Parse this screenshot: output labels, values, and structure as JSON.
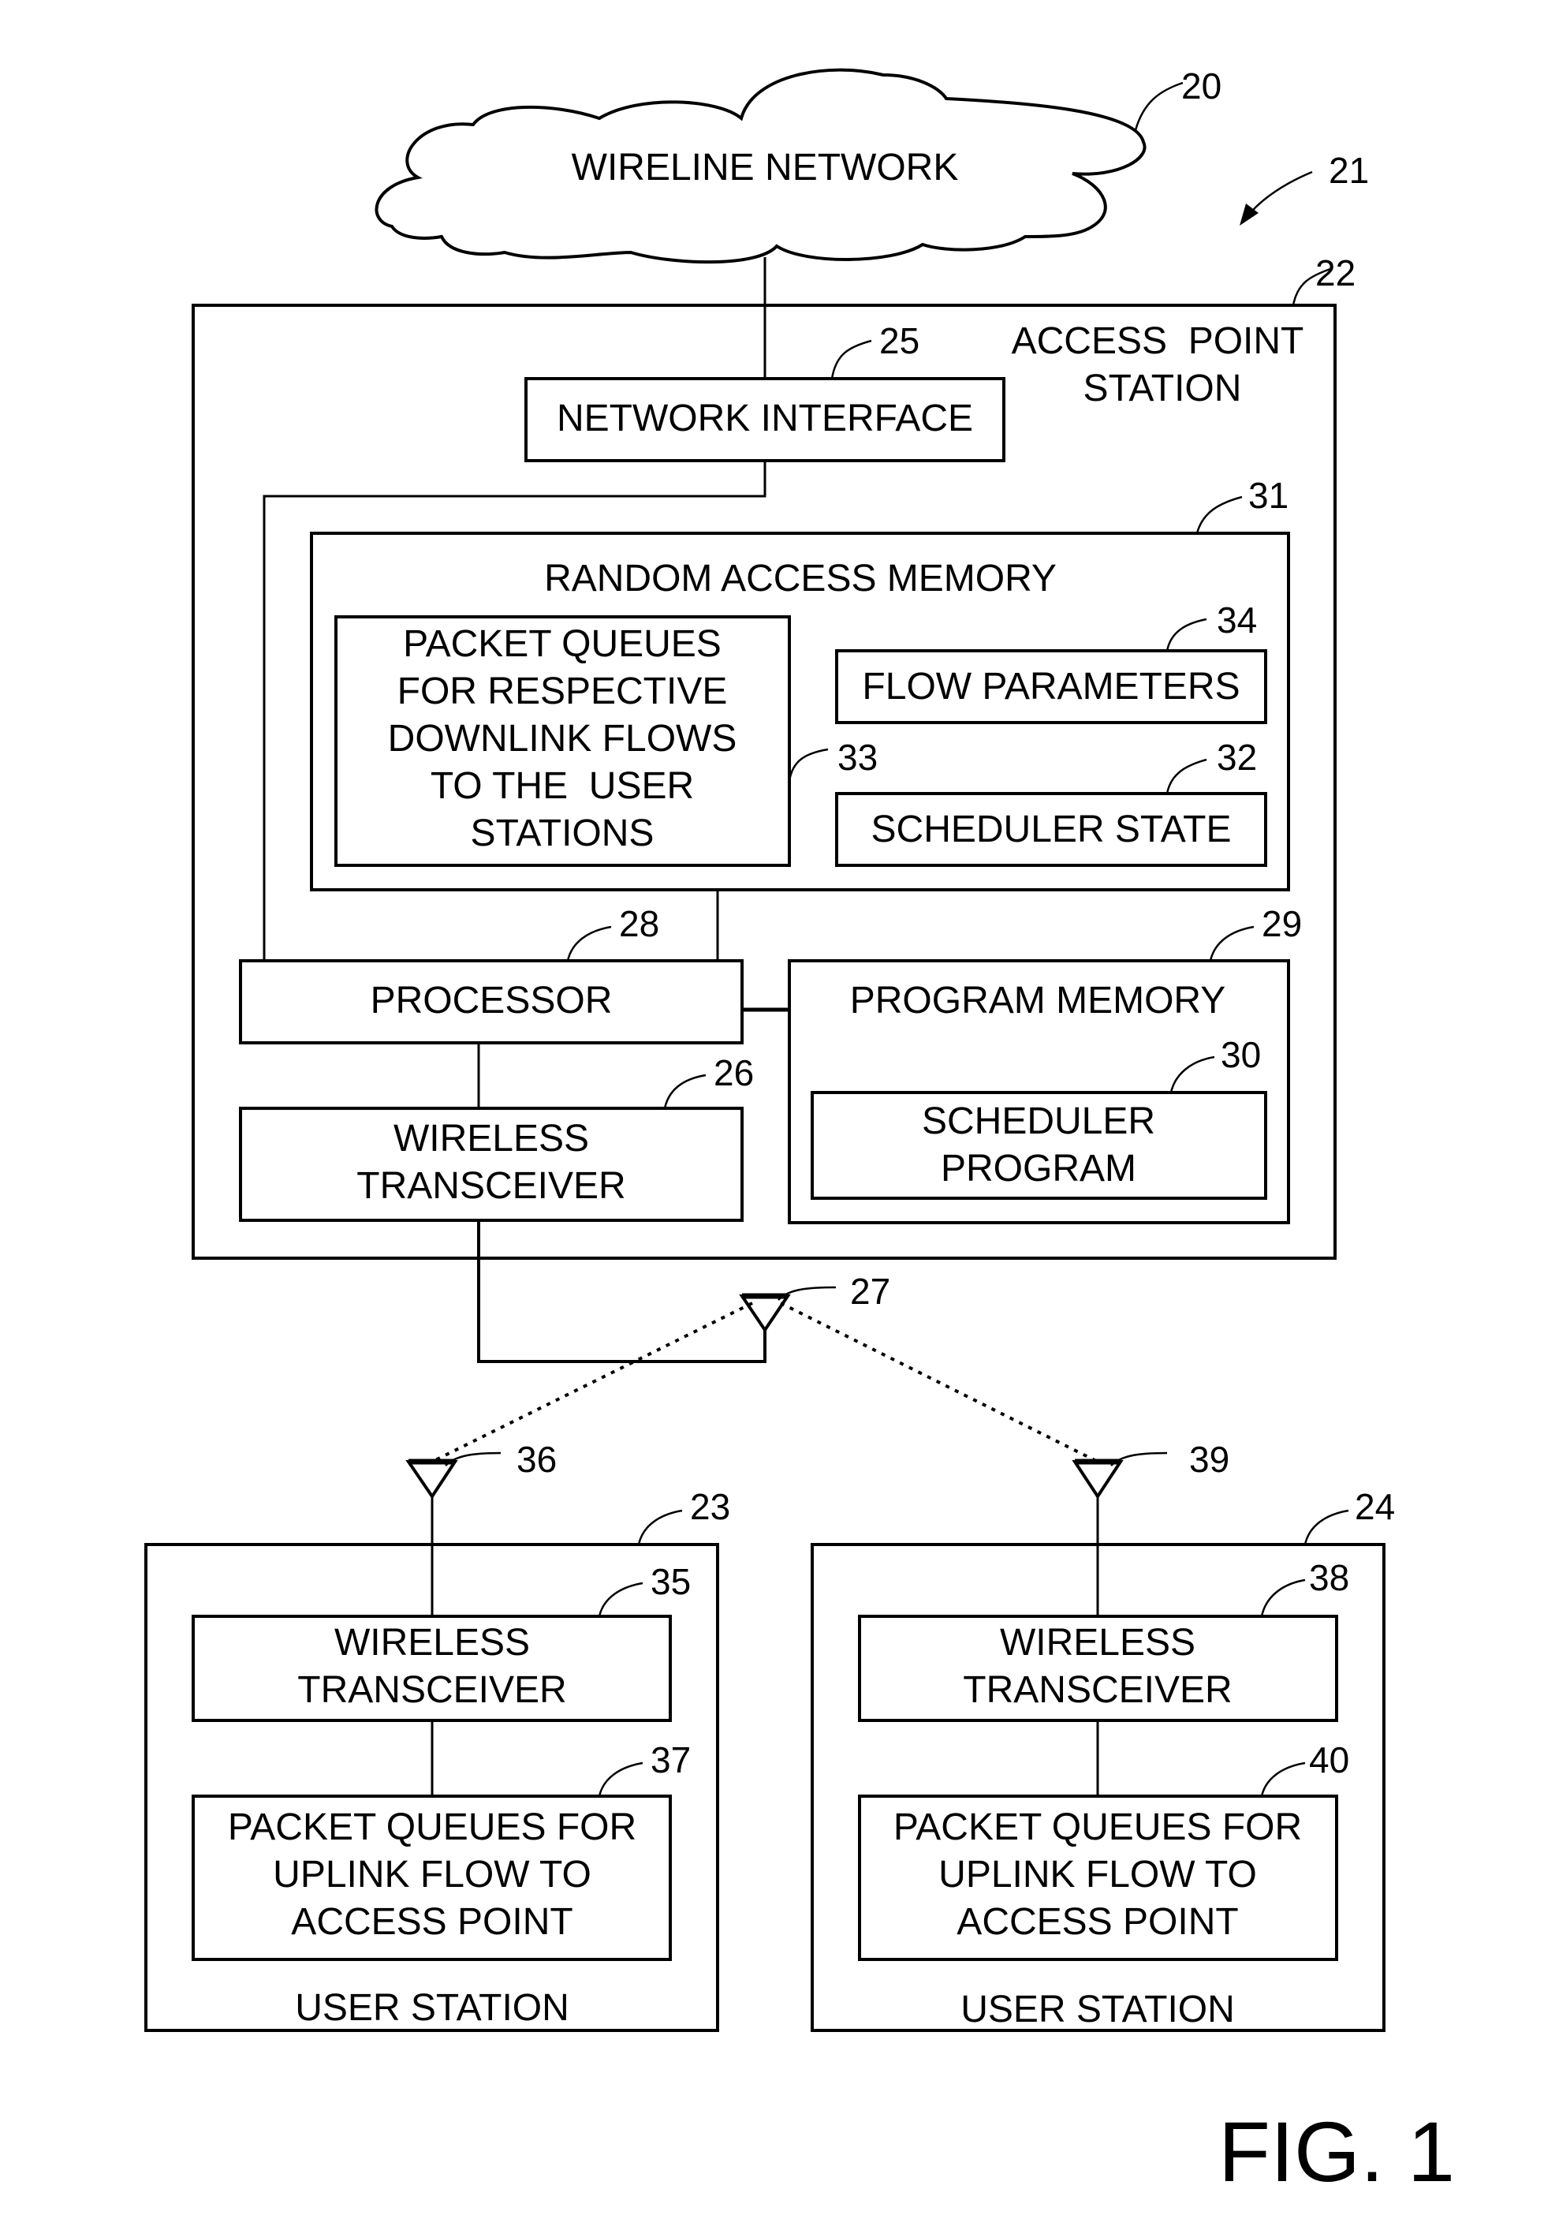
{
  "figure": {
    "caption": "FIG. 1",
    "system_ref": "21"
  },
  "cloud": {
    "label": "WIRELINE NETWORK",
    "ref": "20"
  },
  "access_point": {
    "ref": "22",
    "title_lines": [
      "ACCESS  POINT",
      "STATION"
    ],
    "network_interface": {
      "label": "NETWORK INTERFACE",
      "ref": "25"
    },
    "ram": {
      "ref": "31",
      "title": "RANDOM ACCESS MEMORY",
      "packet_queues": {
        "ref": "33",
        "lines": [
          "PACKET QUEUES",
          "FOR RESPECTIVE",
          "DOWNLINK FLOWS",
          "TO THE  USER",
          "STATIONS"
        ]
      },
      "flow_parameters": {
        "label": "FLOW PARAMETERS",
        "ref": "34"
      },
      "scheduler_state": {
        "label": "SCHEDULER STATE",
        "ref": "32"
      }
    },
    "processor": {
      "label": "PROCESSOR",
      "ref": "28"
    },
    "program_memory": {
      "ref": "29",
      "title": "PROGRAM MEMORY",
      "scheduler_program": {
        "ref": "30",
        "lines": [
          "SCHEDULER",
          "PROGRAM"
        ]
      }
    },
    "wireless_transceiver": {
      "ref": "26",
      "lines": [
        "WIRELESS",
        "TRANSCEIVER"
      ]
    },
    "antenna": {
      "ref": "27"
    }
  },
  "user_stations": [
    {
      "ref": "23",
      "label": "USER STATION",
      "antenna_ref": "36",
      "transceiver": {
        "ref": "35",
        "lines": [
          "WIRELESS",
          "TRANSCEIVER"
        ]
      },
      "queues": {
        "ref": "37",
        "lines": [
          "PACKET QUEUES FOR",
          "UPLINK FLOW TO",
          "ACCESS POINT"
        ]
      }
    },
    {
      "ref": "24",
      "label": "USER STATION",
      "antenna_ref": "39",
      "transceiver": {
        "ref": "38",
        "lines": [
          "WIRELESS",
          "TRANSCEIVER"
        ]
      },
      "queues": {
        "ref": "40",
        "lines": [
          "PACKET QUEUES FOR",
          "UPLINK FLOW TO",
          "ACCESS POINT"
        ]
      }
    }
  ]
}
